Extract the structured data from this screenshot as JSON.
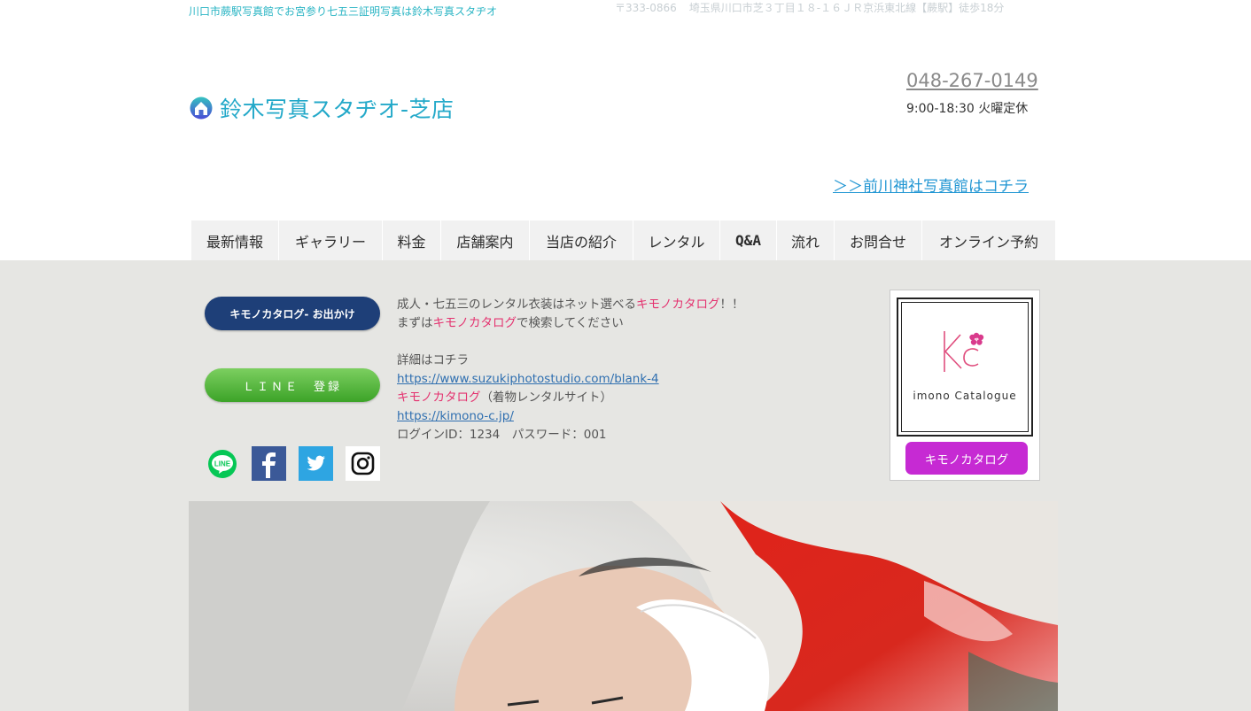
{
  "header": {
    "tagline": "川口市蕨駅写真館でお宮参り七五三証明写真は鈴木写真スタヂオ",
    "address_zip": "〒333-0866",
    "address": "埼玉県川口市芝３丁目１８-１６ＪＲ京浜東北線【蕨駅】徒歩18分",
    "studio_name": "鈴木写真スタヂオ-芝店",
    "phone": "048-267-0149",
    "hours": "9:00-18:30 火曜定休",
    "other_store_link": "＞＞前川神社写真館はコチラ"
  },
  "nav": {
    "items": [
      {
        "label": "最新情報"
      },
      {
        "label": "ギャラリー"
      },
      {
        "label": "料金"
      },
      {
        "label": "店舗案内"
      },
      {
        "label": "当店の紹介"
      },
      {
        "label": "レンタル"
      },
      {
        "label": "Q&A"
      },
      {
        "label": "流れ"
      },
      {
        "label": "お問合せ"
      },
      {
        "label": "オンライン予約"
      }
    ]
  },
  "left": {
    "catalog_button": "キモノカタログ- お出かけ",
    "line_button": "ＬＩＮＥ　登録",
    "social_icons": [
      "line-icon",
      "facebook-icon",
      "twitter-icon",
      "instagram-icon"
    ],
    "line_icon_text": "LINE"
  },
  "info": {
    "line1_a": "成人・七五三のレンタル衣装はネット選べる",
    "line1_b": "キモノカタログ",
    "line1_c": "！！",
    "line2_a": "まずは",
    "line2_b": "キモノカタログ",
    "line2_c": "で検索してください",
    "details": "詳細はコチラ",
    "url1": "https://www.suzukiphotostudio.com/blank-4",
    "line5_a": "キモノカタログ",
    "line5_b": "（着物レンタルサイト）",
    "url2": "https://kimono-c.jp/",
    "login": "ログインID：1234　パスワード：001"
  },
  "card": {
    "image_text": "imono  Catalogue",
    "button": "キモノカタログ"
  },
  "colors": {
    "accent_teal": "#24a9c9",
    "nav_bg": "#f1f1f1",
    "catalog_button": "#1e3f78",
    "line_green": "#3ca328",
    "pink": "#e4326f",
    "card_button": "#c62ad3",
    "content_bg": "#e6e6e3"
  }
}
